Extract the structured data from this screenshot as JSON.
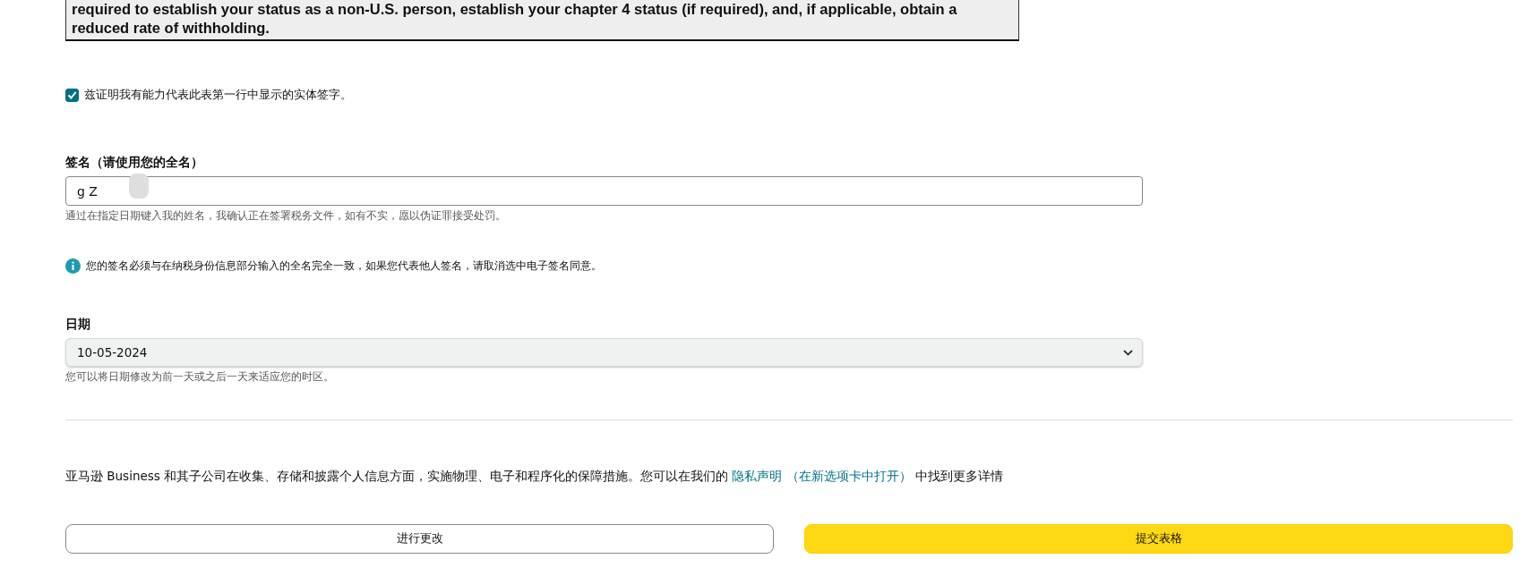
{
  "notice": {
    "lines": [
      "required to establish your status as a non-U.S. person, establish your chapter 4 status (if required), and, if applicable, obtain a",
      "reduced rate of withholding."
    ]
  },
  "certify": {
    "label": "兹证明我有能力代表此表第一行中显示的实体签字。",
    "checked": true
  },
  "signature": {
    "label": "签名（请使用您的全名）",
    "value": "g Z",
    "hint": "通过在指定日期键入我的姓名，我确认正在签署税务文件，如有不实，愿以伪证罪接受处罚。"
  },
  "info": "您的签名必须与在纳税身份信息部分输入的全名完全一致，如果您代表他人签名，请取消选中电子签名同意。",
  "date": {
    "label": "日期",
    "value": "10-05-2024",
    "hint": "您可以将日期修改为前一天或之后一天来适应您的时区。"
  },
  "privacy": {
    "text": "亚马逊 Business 和其子公司在收集、存储和披露个人信息方面，实施物理、电子和程序化的保障措施。您可以在我们的",
    "link": "隐私声明",
    "link_note": "（在新选项卡中打开）",
    "tail": "中找到更多详情"
  },
  "buttons": [
    {
      "label": "进行更改",
      "kind": "secondary"
    },
    {
      "label": "提交表格",
      "kind": "primary"
    }
  ]
}
